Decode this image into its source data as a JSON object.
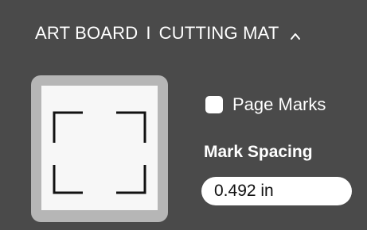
{
  "header": {
    "art_board": "ART BOARD",
    "separator": "I",
    "cutting_mat": "CUTTING MAT",
    "collapse_icon": "chevron-up-icon"
  },
  "page_marks": {
    "label": "Page Marks",
    "checked": false
  },
  "mark_spacing": {
    "label": "Mark Spacing",
    "value": "0.492 in"
  },
  "colors": {
    "panel_bg": "#4a4a4a",
    "preview_frame": "#b6b6b6",
    "preview_page": "#f7f7f7",
    "text": "#ffffff"
  }
}
